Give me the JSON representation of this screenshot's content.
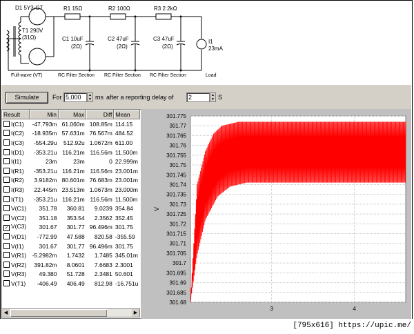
{
  "schematic": {
    "source_name": "D1 5Y3-GT",
    "transformer": "T1 290V",
    "transformer_r": "(31Ω)",
    "r1": "R1 15Ω",
    "r2": "R2 100Ω",
    "r3": "R3 2.2kΩ",
    "c1": "C1 10uF",
    "c1_esr": "(2Ω)",
    "c2": "C2 47uF",
    "c2_esr": "(2Ω)",
    "c3": "C3 47uF",
    "c3_esr": "(2Ω)",
    "load_name": "I1",
    "load_value": "23mA",
    "section_fullwave": "Full-wave (VT)",
    "section_rc1": "RC Filter Section",
    "section_rc2": "RC Filter Section",
    "section_rc3": "RC Filter Section",
    "section_load": "Load"
  },
  "toolbar": {
    "simulate_label": "Simulate",
    "for_label": "For",
    "duration_value": "5,000",
    "ms_label": "ms",
    "delay_text": "after a reporting delay of",
    "delay_value": "2",
    "s_label": "S"
  },
  "table": {
    "headers": [
      "Result",
      "Min",
      "Max",
      "Diff",
      "Mean"
    ],
    "rows": [
      {
        "name": "I(C1)",
        "checked": false,
        "min": "-47.793m",
        "max": "61.060m",
        "diff": "108.85m",
        "mean": "114.15"
      },
      {
        "name": "I(C2)",
        "checked": false,
        "min": "-18.935m",
        "max": "57.631m",
        "diff": "76.567m",
        "mean": "484.52"
      },
      {
        "name": "I(C3)",
        "checked": false,
        "min": "-554.29u",
        "max": "512.92u",
        "diff": "1.0672m",
        "mean": "611.00"
      },
      {
        "name": "I(D1)",
        "checked": false,
        "min": "-353.21u",
        "max": "116.21m",
        "diff": "116.56m",
        "mean": "11.500m"
      },
      {
        "name": "I(I1)",
        "checked": false,
        "min": "23m",
        "max": "23m",
        "diff": "0",
        "mean": "22.999m"
      },
      {
        "name": "I(R1)",
        "checked": false,
        "min": "-353.21u",
        "max": "116.21m",
        "diff": "116.56m",
        "mean": "23.001m"
      },
      {
        "name": "I(R2)",
        "checked": false,
        "min": "3.9182m",
        "max": "80.601m",
        "diff": "76.683m",
        "mean": "23.001m"
      },
      {
        "name": "I(R3)",
        "checked": false,
        "min": "22.445m",
        "max": "23.513m",
        "diff": "1.0673m",
        "mean": "23.000m"
      },
      {
        "name": "I(T1)",
        "checked": false,
        "min": "-353.21u",
        "max": "116.21m",
        "diff": "116.56m",
        "mean": "11.500m"
      },
      {
        "name": "V(C1)",
        "checked": false,
        "min": "351.78",
        "max": "360.81",
        "diff": "9.0239",
        "mean": "354.84"
      },
      {
        "name": "V(C2)",
        "checked": false,
        "min": "351.18",
        "max": "353.54",
        "diff": "2.3562",
        "mean": "352.45"
      },
      {
        "name": "V(C3)",
        "checked": true,
        "min": "301.67",
        "max": "301.77",
        "diff": "96.496m",
        "mean": "301.75"
      },
      {
        "name": "V(D1)",
        "checked": false,
        "min": "-772.99",
        "max": "47.588",
        "diff": "820.58",
        "mean": "-355.59"
      },
      {
        "name": "V(I1)",
        "checked": false,
        "min": "301.67",
        "max": "301.77",
        "diff": "96.496m",
        "mean": "301.75"
      },
      {
        "name": "V(R1)",
        "checked": false,
        "min": "-5.2982m",
        "max": "1.7432",
        "diff": "1.7485",
        "mean": "345.01m"
      },
      {
        "name": "V(R2)",
        "checked": false,
        "min": "391.82m",
        "max": "8.0601",
        "diff": "7.6683",
        "mean": "2.3001"
      },
      {
        "name": "V(R3)",
        "checked": false,
        "min": "49.380",
        "max": "51.728",
        "diff": "2.3481",
        "mean": "50.601"
      },
      {
        "name": "V(T1)",
        "checked": false,
        "min": "-406.49",
        "max": "406.49",
        "diff": "812.98",
        "mean": "-16.751u"
      }
    ]
  },
  "chart_data": {
    "type": "line",
    "title": "",
    "xlabel": "",
    "ylabel": "V",
    "ylim": [
      301.68,
      301.775
    ],
    "yticks": [
      "301.775",
      "301.77",
      "301.765",
      "301.76",
      "301.755",
      "301.75",
      "301.745",
      "301.74",
      "301.735",
      "301.73",
      "301.725",
      "301.72",
      "301.715",
      "301.71",
      "301.705",
      "301.7",
      "301.695",
      "301.69",
      "301.685",
      "301.68"
    ],
    "xticks": [
      "3",
      "4"
    ],
    "xlim": [
      2.02,
      4.62
    ],
    "series_color": "#ff0000",
    "plot_background": "#ffffff",
    "grid": true,
    "series": [
      {
        "upper_envelope": [
          [
            2.02,
            301.68
          ],
          [
            2.1,
            301.74
          ],
          [
            2.2,
            301.757
          ],
          [
            2.3,
            301.766
          ],
          [
            2.4,
            301.77
          ],
          [
            2.6,
            301.772
          ],
          [
            3.0,
            301.772
          ],
          [
            4.6,
            301.772
          ]
        ],
        "lower_envelope": [
          [
            2.02,
            301.68
          ],
          [
            2.1,
            301.704
          ],
          [
            2.2,
            301.722
          ],
          [
            2.35,
            301.734
          ],
          [
            2.5,
            301.739
          ],
          [
            2.7,
            301.741
          ],
          [
            3.0,
            301.741
          ],
          [
            4.6,
            301.741
          ]
        ]
      }
    ]
  },
  "status_text": "[795x616] https://upic.me/"
}
